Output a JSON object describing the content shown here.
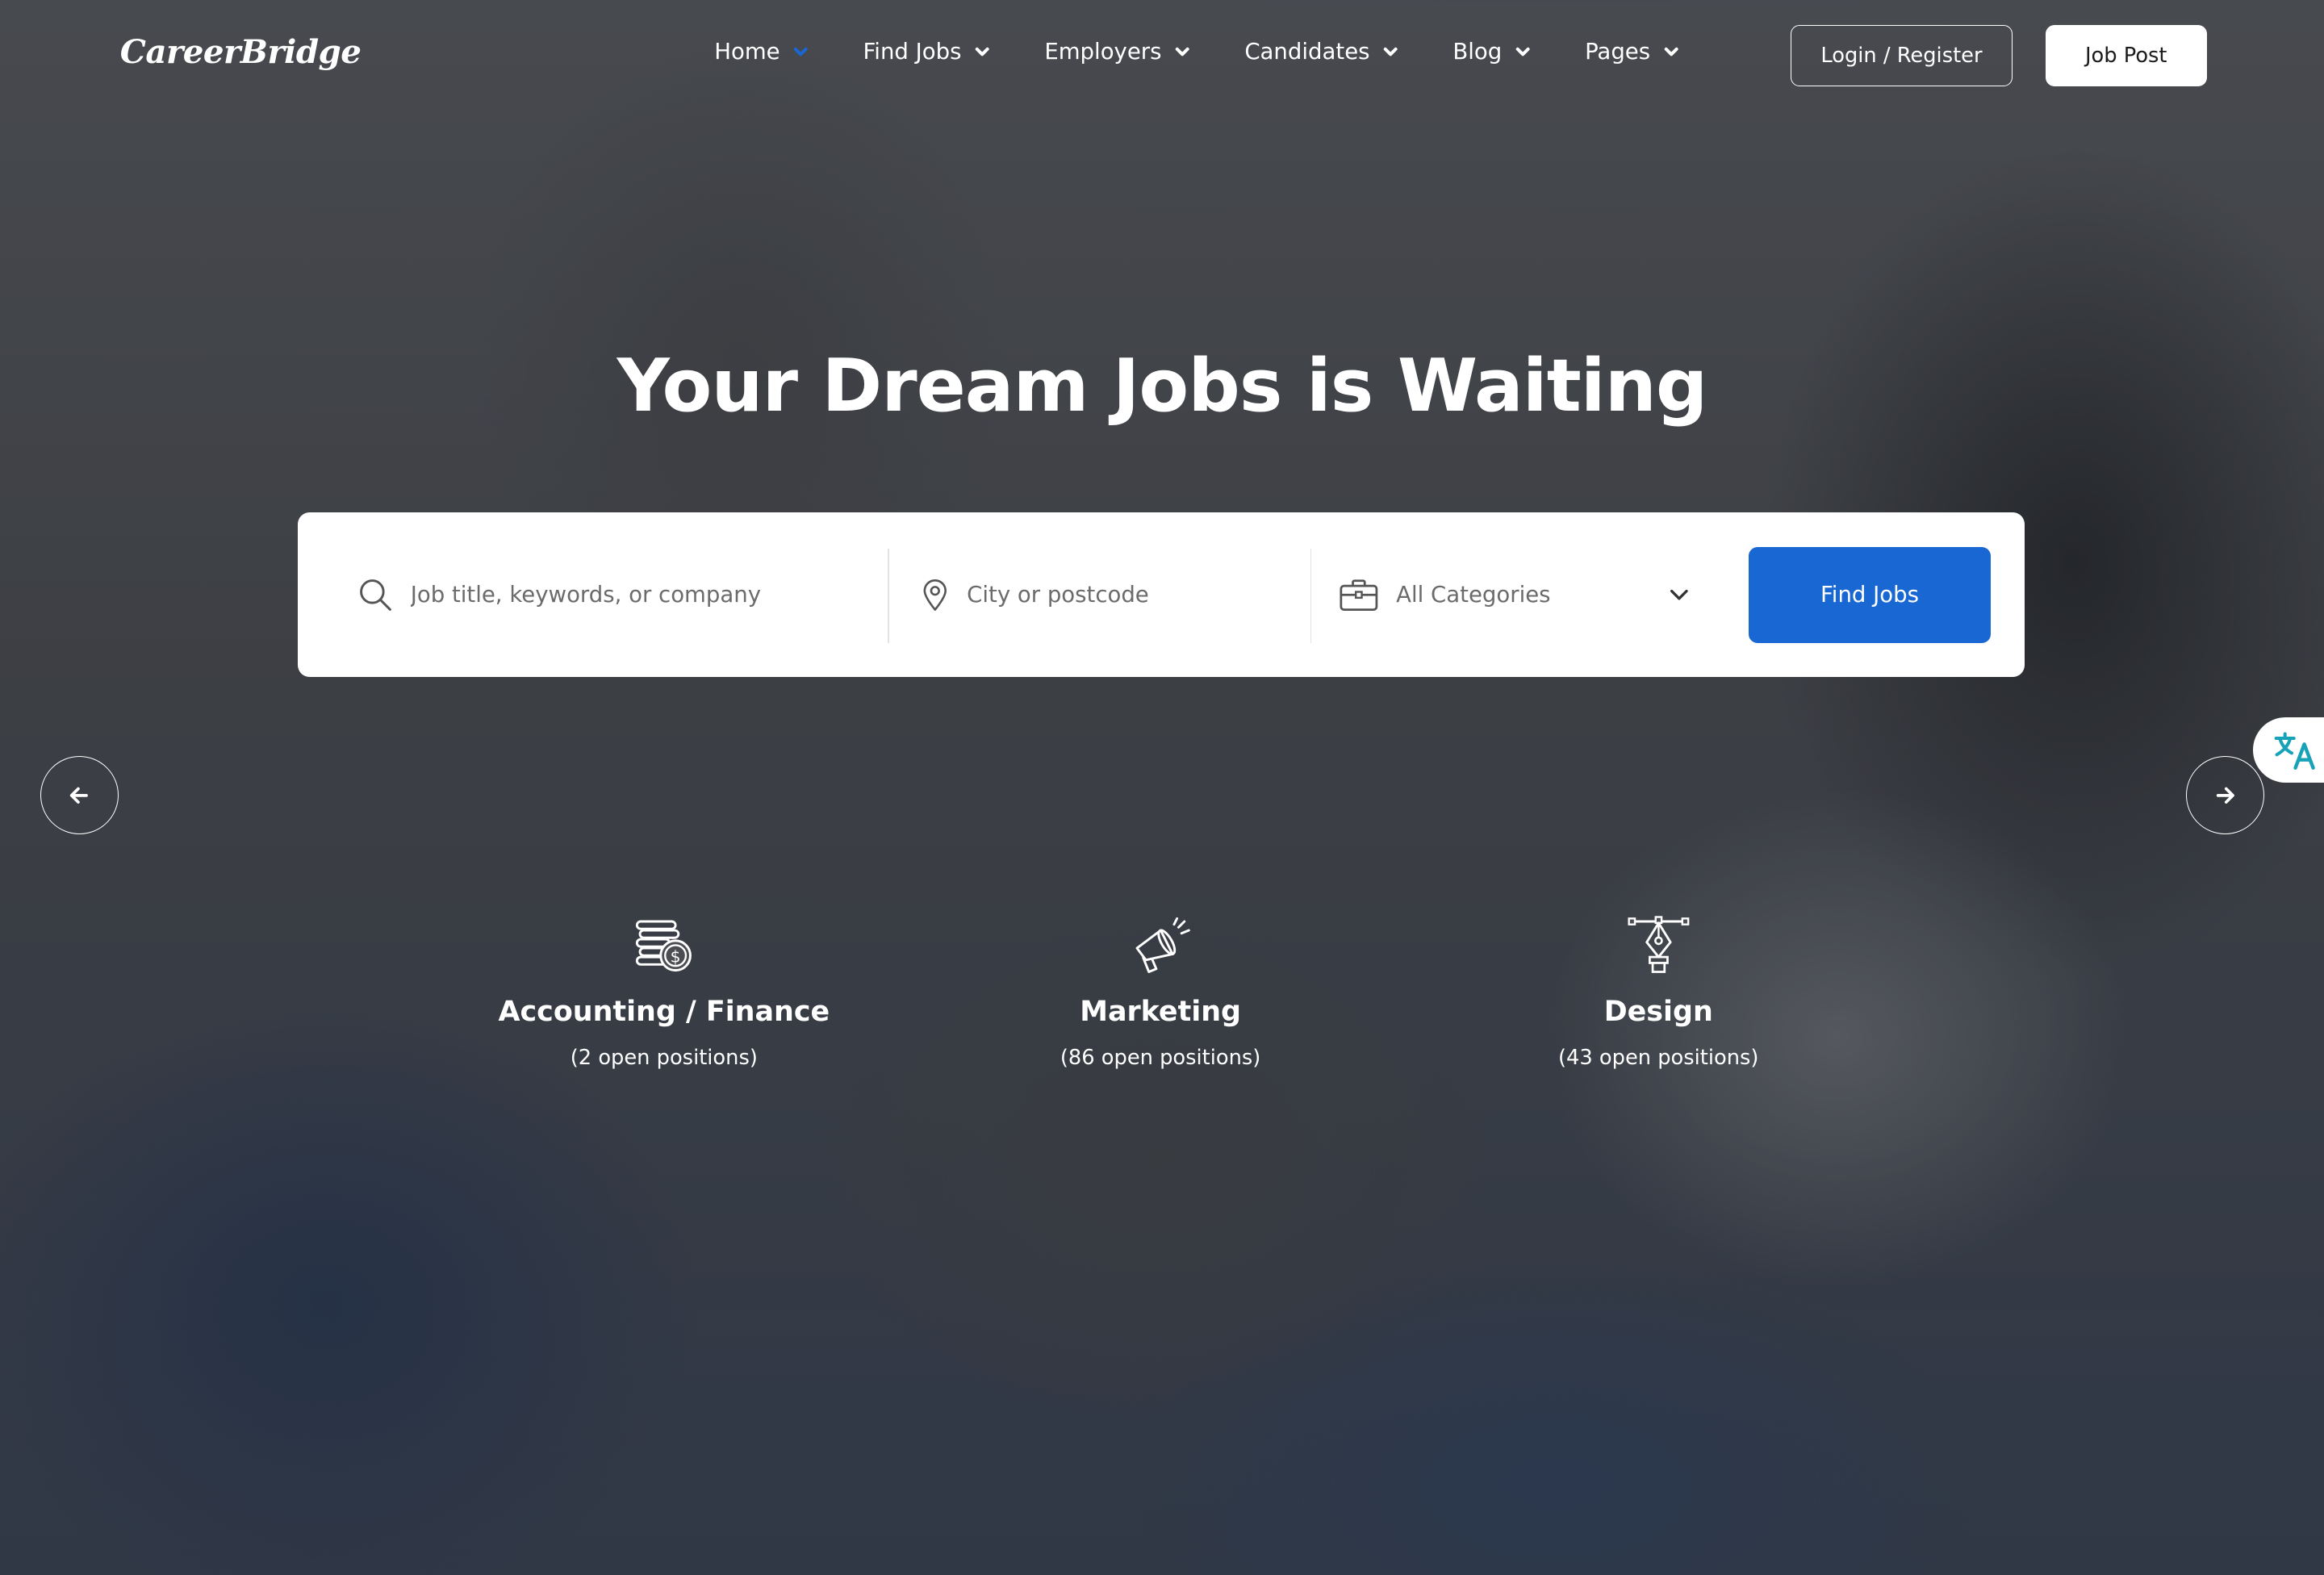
{
  "header": {
    "logo": "CareerBridge",
    "nav": [
      {
        "label": "Home"
      },
      {
        "label": "Find Jobs"
      },
      {
        "label": "Employers"
      },
      {
        "label": "Candidates"
      },
      {
        "label": "Blog"
      },
      {
        "label": "Pages"
      }
    ],
    "login_label": "Login / Register",
    "post_label": "Job Post"
  },
  "hero": {
    "title": "Your Dream Jobs is Waiting"
  },
  "search": {
    "keyword_placeholder": "Job title, keywords, or company",
    "city_placeholder": "City or postcode",
    "category_value": "All Categories",
    "button_label": "Find Jobs"
  },
  "categories": [
    {
      "name": "Accounting / Finance",
      "count": "(2 open positions)",
      "icon": "coins-dollar-icon"
    },
    {
      "name": "Marketing",
      "count": "(86 open positions)",
      "icon": "megaphone-icon"
    },
    {
      "name": "Design",
      "count": "(43 open positions)",
      "icon": "pen-nib-icon"
    }
  ],
  "colors": {
    "accent": "#1967d2",
    "home_chevron": "#1967d2",
    "translate_icon": "#17a2b8"
  }
}
